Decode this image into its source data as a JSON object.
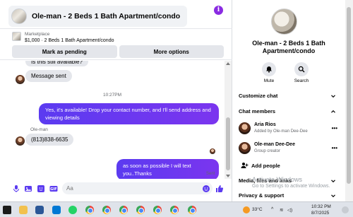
{
  "header": {
    "title": "Ole-man - 2 Beds 1 Bath Apartment/condo",
    "info_icon": "i"
  },
  "listing": {
    "category": "Marketplace",
    "summary": "$1,000 · 2 Beds 1 Bath Apartment/condo",
    "mark_pending_label": "Mark as pending",
    "more_options_label": "More options"
  },
  "messages": {
    "partial_message": "Is this still available?",
    "message_sent": "Message sent",
    "timestamp": "10:27PM",
    "outgoing_1": "Yes, it's available! Drop your contact number, and I'll send address and viewing details",
    "sender_name": "Ole-man",
    "incoming_phone": "(813)838-6635",
    "outgoing_2": "as soon as possible I will text you..Thanks",
    "status": "Sent"
  },
  "composer": {
    "placeholder": "Aa"
  },
  "side_panel": {
    "title": "Ole-man - 2 Beds 1 Bath Apartment/condo",
    "actions": [
      {
        "label": "Mute",
        "icon": "bell-icon"
      },
      {
        "label": "Search",
        "icon": "search-icon"
      }
    ],
    "customize_chat": "Customize chat",
    "chat_members": "Chat members",
    "members": [
      {
        "name": "Aria Rios",
        "subtitle": "Added by Ole-man Dee-Dee"
      },
      {
        "name": "Ole-man Dee-Dee",
        "subtitle": "Group creator"
      }
    ],
    "add_people": "Add people",
    "media_files_links": "Media, files and links",
    "privacy_support": "Privacy & support"
  },
  "watermark": {
    "line1": "Activate Windows",
    "line2": "Go to Settings to activate Windows."
  },
  "taskbar": {
    "weather": "33°C",
    "time": "10:32 PM",
    "date": "8/7/2025"
  },
  "colors": {
    "accent": "#5b3bf0",
    "info_purple": "#8a2be2",
    "bubble_gray": "#e4e6eb"
  }
}
